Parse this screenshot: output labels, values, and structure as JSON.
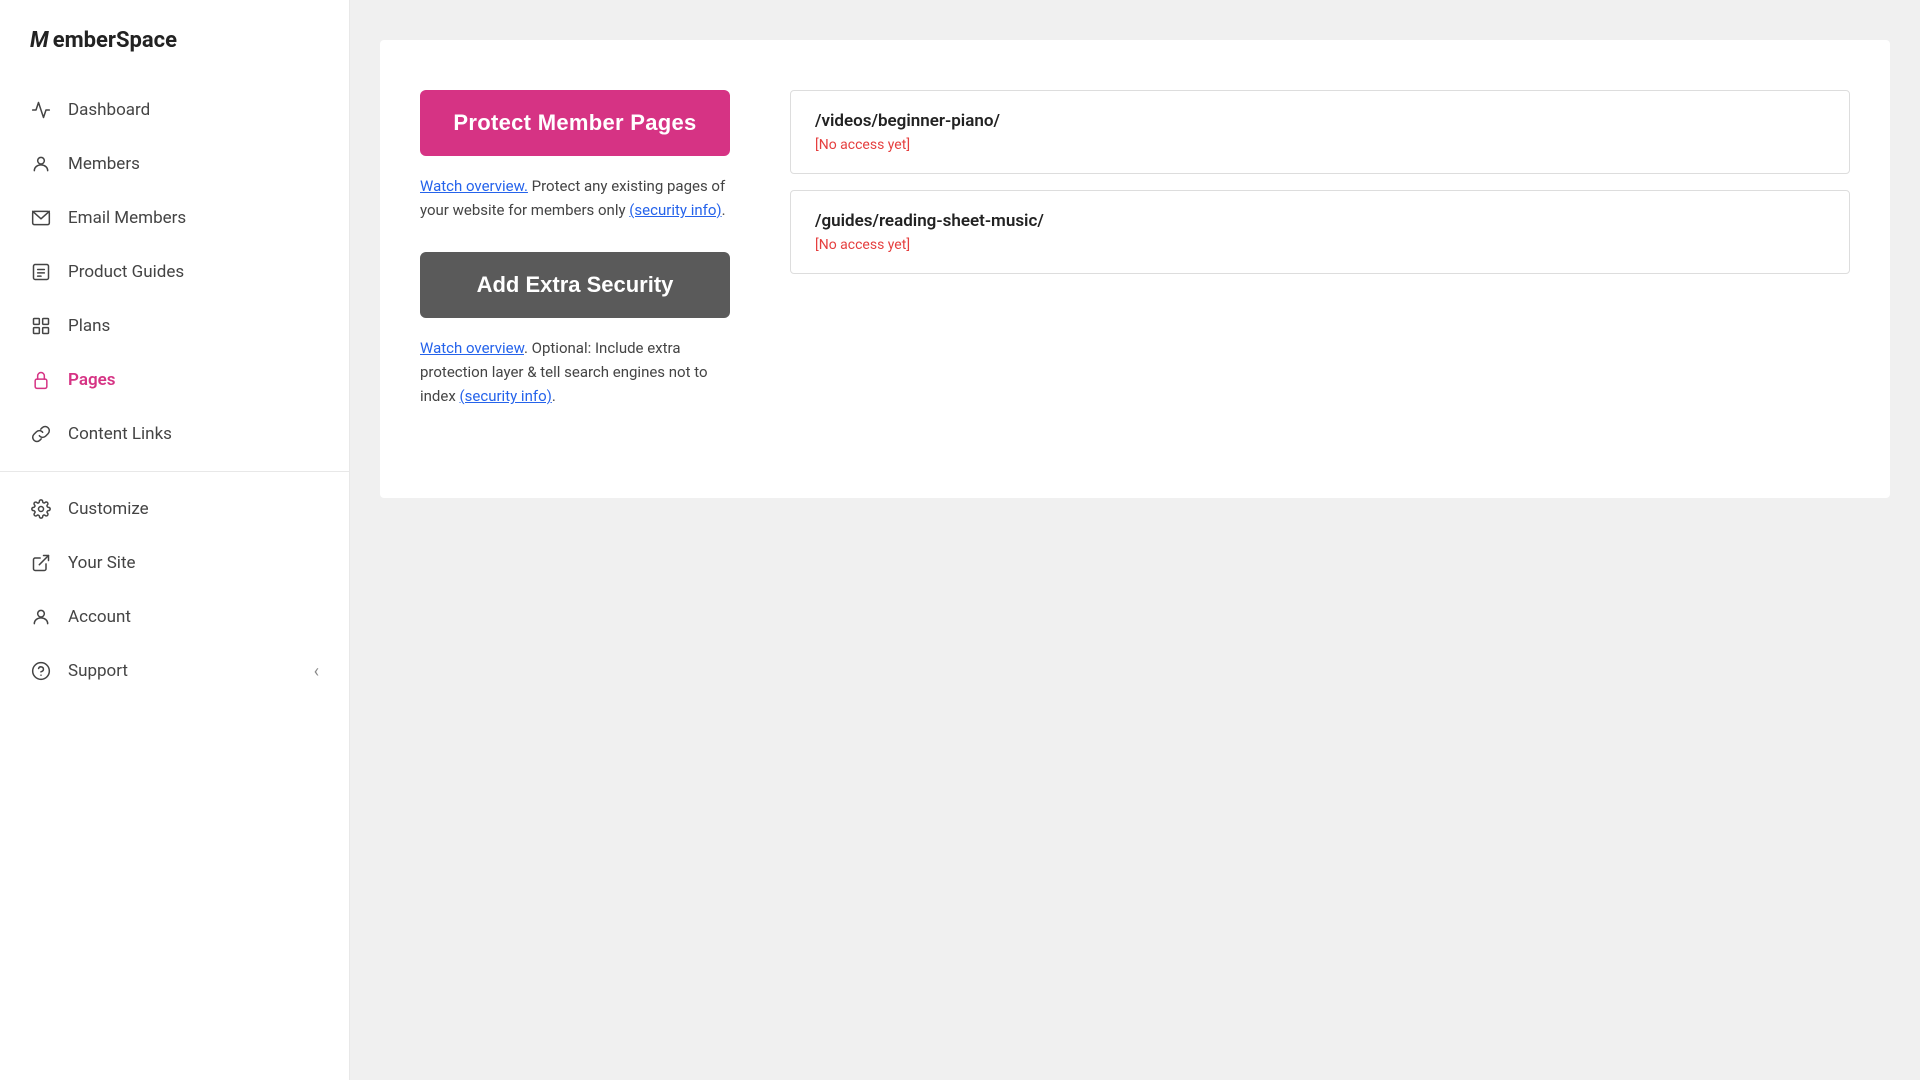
{
  "logo": {
    "text": "MemberSpace"
  },
  "sidebar": {
    "items": [
      {
        "id": "dashboard",
        "label": "Dashboard",
        "icon": "chart-icon",
        "active": false
      },
      {
        "id": "members",
        "label": "Members",
        "icon": "members-icon",
        "active": false
      },
      {
        "id": "email-members",
        "label": "Email Members",
        "icon": "email-icon",
        "active": false
      },
      {
        "id": "product-guides",
        "label": "Product Guides",
        "icon": "guides-icon",
        "active": false
      },
      {
        "id": "plans",
        "label": "Plans",
        "icon": "plans-icon",
        "active": false
      },
      {
        "id": "pages",
        "label": "Pages",
        "icon": "lock-icon",
        "active": true
      },
      {
        "id": "content-links",
        "label": "Content Links",
        "icon": "link-icon",
        "active": false
      }
    ],
    "bottom_items": [
      {
        "id": "customize",
        "label": "Customize",
        "icon": "gear-icon",
        "active": false
      },
      {
        "id": "your-site",
        "label": "Your Site",
        "icon": "external-icon",
        "active": false
      },
      {
        "id": "account",
        "label": "Account",
        "icon": "account-icon",
        "active": false
      },
      {
        "id": "support",
        "label": "Support",
        "icon": "support-icon",
        "active": false
      }
    ],
    "collapse_label": "‹"
  },
  "main": {
    "protect_button_label": "Protect Member Pages",
    "protect_description_link": "Watch overview.",
    "protect_description_text": " Protect any existing pages of your website for members only ",
    "protect_description_link2": "(security info)",
    "protect_description_end": ".",
    "security_button_label": "Add Extra Security",
    "security_description_link": "Watch overview",
    "security_description_text": ". Optional: Include extra protection layer & tell search engines not to index ",
    "security_description_link2": "(security info)",
    "security_description_end": ".",
    "pages": [
      {
        "path": "/videos/beginner-piano/",
        "status": "[No access yet]"
      },
      {
        "path": "/guides/reading-sheet-music/",
        "status": "[No access yet]"
      }
    ]
  }
}
